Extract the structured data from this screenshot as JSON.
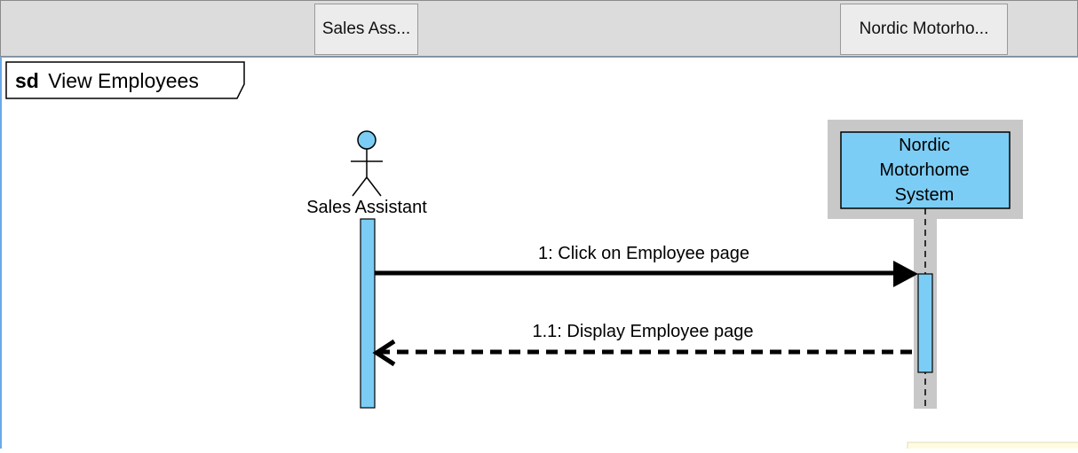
{
  "header": {
    "tabs": [
      {
        "label": "Sales Ass..."
      },
      {
        "label": "Nordic Motorho..."
      }
    ]
  },
  "frame": {
    "keyword": "sd",
    "name": "View Employees"
  },
  "lifelines": [
    {
      "type": "actor",
      "name": "Sales Assistant"
    },
    {
      "type": "object",
      "name_lines": [
        "Nordic",
        "Motorhome",
        "System"
      ]
    }
  ],
  "messages": [
    {
      "label": "1: Click on Employee page",
      "kind": "synchronous",
      "from": "Sales Assistant",
      "to": "Nordic Motorhome System"
    },
    {
      "label": "1.1: Display Employee page",
      "kind": "return",
      "from": "Nordic Motorhome System",
      "to": "Sales Assistant"
    }
  ],
  "colors": {
    "element_fill": "#7ccdf5",
    "object_shadow": "#c8c8c8",
    "lifeline_shadow": "#c8c8c8",
    "canvas_border": "#6aa9e8",
    "note_fill": "#fffbe0"
  }
}
